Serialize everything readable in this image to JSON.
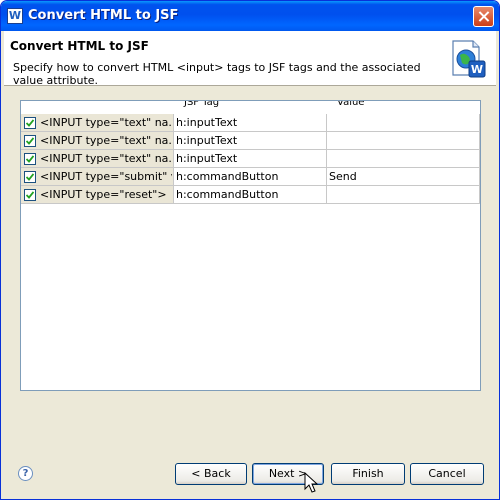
{
  "window": {
    "title": "Convert HTML to JSF"
  },
  "header": {
    "title": "Convert HTML to JSF",
    "description": "Specify how to convert HTML <input> tags to JSF tags and the associated value attribute."
  },
  "table": {
    "headers": [
      "JSF Tag",
      "Value"
    ],
    "rows": [
      {
        "checked": true,
        "input": "<INPUT type=\"text\" na...",
        "tag": "h:inputText",
        "value": ""
      },
      {
        "checked": true,
        "input": "<INPUT type=\"text\" na...",
        "tag": "h:inputText",
        "value": ""
      },
      {
        "checked": true,
        "input": "<INPUT type=\"text\" na...",
        "tag": "h:inputText",
        "value": ""
      },
      {
        "checked": true,
        "input": "<INPUT type=\"submit\" v...",
        "tag": "h:commandButton",
        "value": "Send"
      },
      {
        "checked": true,
        "input": "<INPUT type=\"reset\">",
        "tag": "h:commandButton",
        "value": ""
      }
    ]
  },
  "footer": {
    "help": "?",
    "back": "< Back",
    "next": "Next >",
    "finish": "Finish",
    "cancel": "Cancel"
  },
  "icons": {
    "app": "wizard-app-icon",
    "header": "web-page-globe-icon",
    "cursor": "mouse-pointer-icon"
  }
}
